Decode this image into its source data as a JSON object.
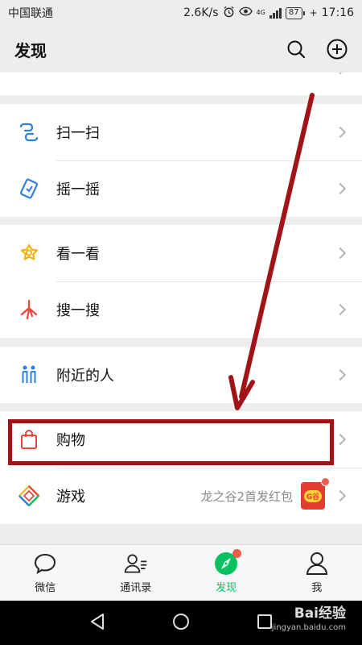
{
  "status_bar": {
    "carrier": "中国联通",
    "speed": "2.6K/s",
    "network": "4G",
    "battery": "87",
    "time": "17:16"
  },
  "header": {
    "title": "发现",
    "search_icon": "search-icon",
    "add_icon": "plus-circle-icon"
  },
  "groups": [
    {
      "items": [
        {
          "label": "扫一扫",
          "icon": "scan-icon"
        },
        {
          "label": "摇一摇",
          "icon": "shake-icon"
        }
      ]
    },
    {
      "items": [
        {
          "label": "看一看",
          "icon": "top-stories-icon"
        },
        {
          "label": "搜一搜",
          "icon": "search-star-icon"
        }
      ]
    },
    {
      "items": [
        {
          "label": "附近的人",
          "icon": "people-nearby-icon"
        }
      ]
    },
    {
      "items": [
        {
          "label": "购物",
          "icon": "shopping-bag-icon"
        },
        {
          "label": "游戏",
          "icon": "games-icon",
          "subtitle": "龙之谷2首发红包",
          "badge_text": "G谷"
        }
      ]
    }
  ],
  "tabs": [
    {
      "label": "微信",
      "icon": "chat-icon",
      "active": false
    },
    {
      "label": "通讯录",
      "icon": "contacts-icon",
      "active": false
    },
    {
      "label": "发现",
      "icon": "discover-icon",
      "active": true
    },
    {
      "label": "我",
      "icon": "me-icon",
      "active": false
    }
  ],
  "watermark": {
    "brand": "Bai经验",
    "url": "jingyan.baidu.com"
  },
  "colors": {
    "accent": "#07c160",
    "highlight": "#a01418",
    "badge_red": "#f15b4a"
  }
}
